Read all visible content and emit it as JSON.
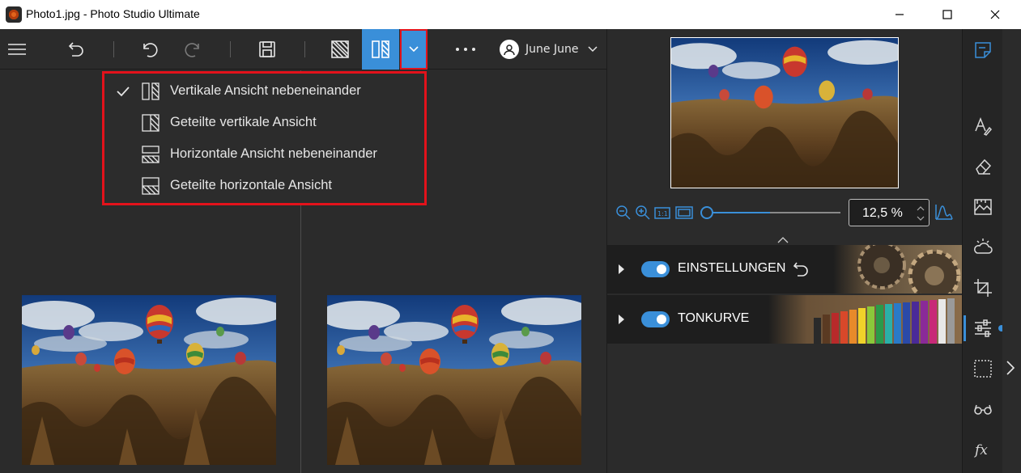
{
  "window": {
    "title": "Photo1.jpg - Photo Studio Ultimate",
    "controls": [
      "minimize-icon",
      "maximize-icon",
      "close-icon"
    ]
  },
  "toolbar": {
    "items": [
      "hamburger-menu-icon",
      "undo-all-icon",
      "undo-icon",
      "redo-icon",
      "save-icon",
      "split-view-icon",
      "vertical-side-by-side-icon",
      "chevron-down-icon",
      "more-icon"
    ],
    "user_name": "June June"
  },
  "view_menu": {
    "items": [
      {
        "label": "Vertikale Ansicht nebeneinander",
        "checked": true,
        "icon": "vertical-side-by-side-icon"
      },
      {
        "label": "Geteilte vertikale Ansicht",
        "checked": false,
        "icon": "split-vertical-icon"
      },
      {
        "label": "Horizontale Ansicht nebeneinander",
        "checked": false,
        "icon": "horizontal-side-by-side-icon"
      },
      {
        "label": "Geteilte horizontale Ansicht",
        "checked": false,
        "icon": "split-horizontal-icon"
      }
    ]
  },
  "zoom": {
    "value": "12,5 %",
    "slider_fraction": 0.47
  },
  "panels": [
    {
      "label": "EINSTELLUNGEN",
      "enabled": true,
      "art": "gears"
    },
    {
      "label": "TONKURVE",
      "enabled": true,
      "art": "colored-pencils"
    }
  ],
  "tools": [
    "notes-icon",
    "text-icon",
    "eraser-icon",
    "landscape-icon",
    "weather-icon",
    "crop-icon",
    "sliders-icon",
    "selection-icon",
    "glasses-icon",
    "fx-icon"
  ],
  "colors": {
    "accent": "#3a8fd9",
    "highlight": "#e3121b",
    "background": "#2b2b2b"
  }
}
